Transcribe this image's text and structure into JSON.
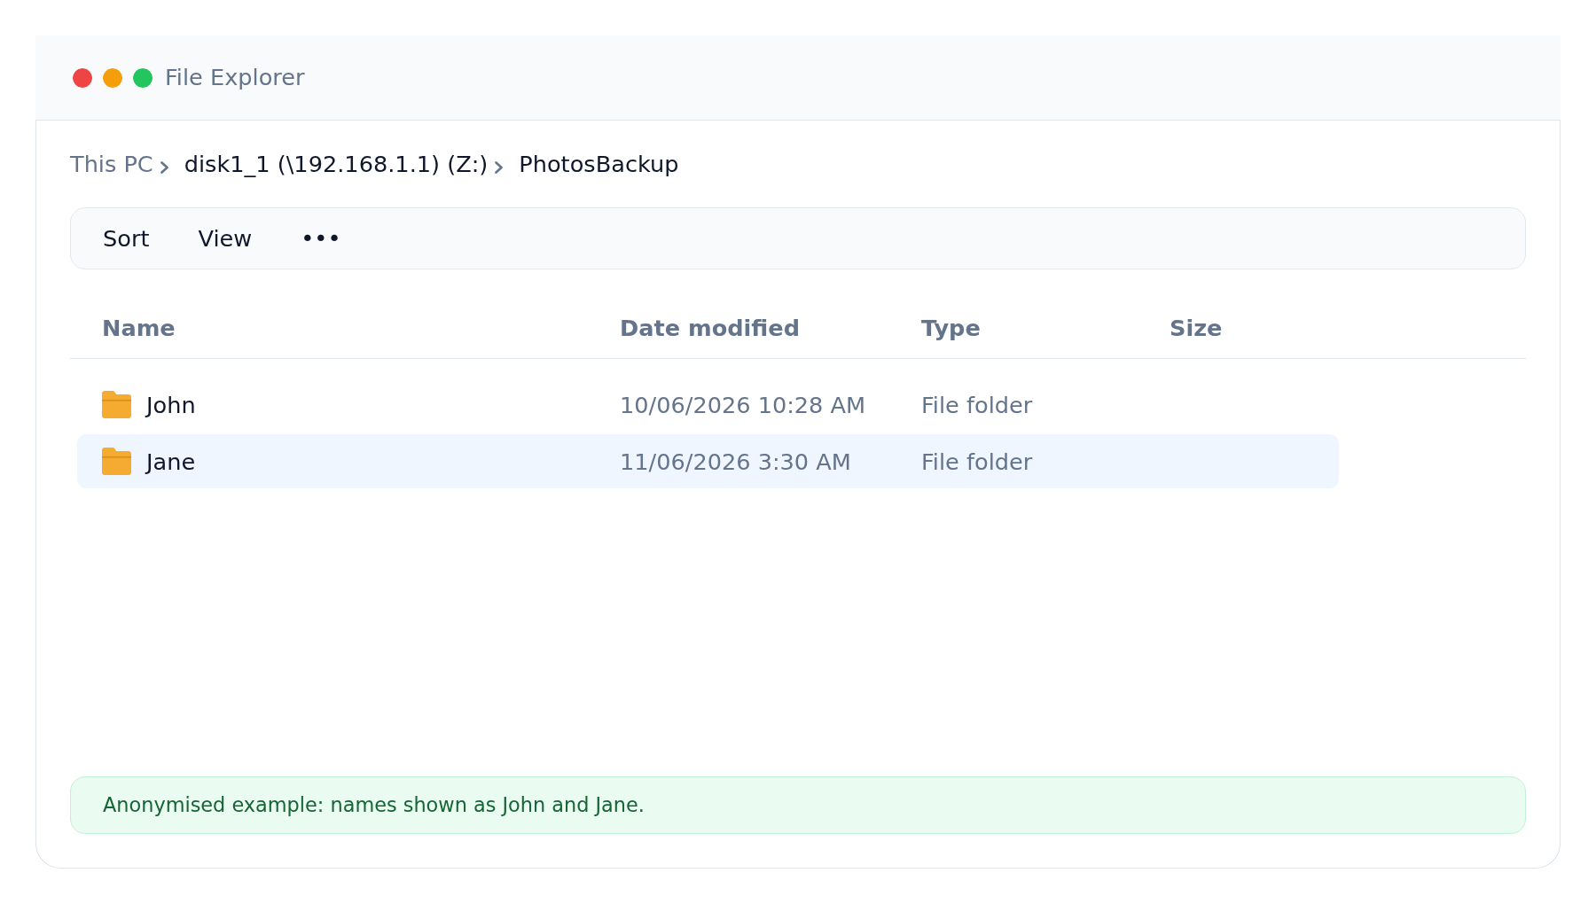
{
  "window": {
    "title": "File Explorer"
  },
  "breadcrumb": [
    {
      "label": "This PC",
      "muted": true
    },
    {
      "label": "disk1_1 (\\192.168.1.1) (Z:)",
      "muted": false
    },
    {
      "label": "PhotosBackup",
      "muted": false
    }
  ],
  "toolbar": [
    "Sort",
    "View",
    "•••"
  ],
  "table": {
    "columns": [
      "Name",
      "Date modified",
      "Type",
      "Size"
    ],
    "rows": [
      {
        "name": "John",
        "date_modified": "10/06/2026 10:28 AM",
        "type": "File folder",
        "selected": false
      },
      {
        "name": "Jane",
        "date_modified": "11/06/2026 3:30 AM",
        "type": "File folder",
        "selected": true
      }
    ]
  },
  "note": "Anonymised example: names shown as John and Jane."
}
